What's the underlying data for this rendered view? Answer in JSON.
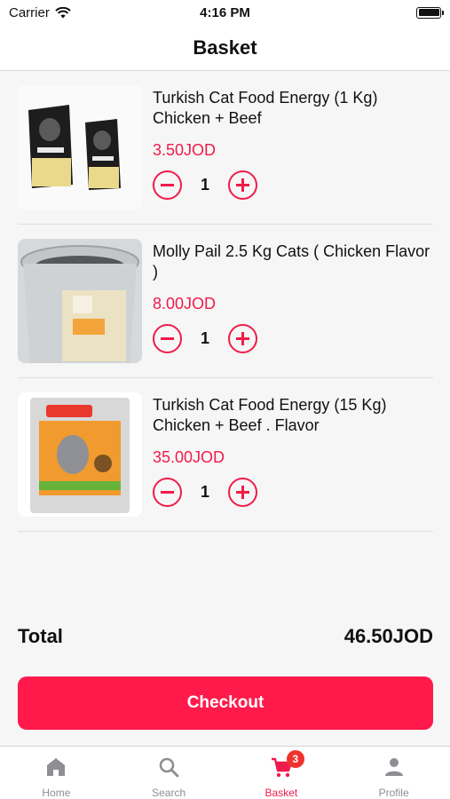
{
  "status_bar": {
    "carrier": "Carrier",
    "time": "4:16 PM"
  },
  "header": {
    "title": "Basket"
  },
  "cart": {
    "items": [
      {
        "name": "Turkish Cat Food Energy (1 Kg) Chicken + Beef",
        "price": "3.50JOD",
        "quantity": "1",
        "image": "cat-food-bags-photo"
      },
      {
        "name": "Molly Pail 2.5 Kg Cats ( Chicken Flavor )",
        "price": "8.00JOD",
        "quantity": "1",
        "image": "cat-food-pail-photo"
      },
      {
        "name": "Turkish Cat Food Energy (15 Kg) Chicken + Beef . Flavor",
        "price": "35.00JOD",
        "quantity": "1",
        "image": "cat-food-large-bag-photo"
      }
    ],
    "total_label": "Total",
    "total_value": "46.50JOD",
    "checkout_label": "Checkout"
  },
  "tab_bar": {
    "tabs": [
      {
        "label": "Home",
        "icon": "home-icon"
      },
      {
        "label": "Search",
        "icon": "search-icon"
      },
      {
        "label": "Basket",
        "icon": "cart-icon",
        "badge": "3",
        "active": true
      },
      {
        "label": "Profile",
        "icon": "person-icon"
      }
    ]
  },
  "colors": {
    "accent": "#f01b4a",
    "checkout": "#ff1a4b",
    "badge": "#f0322f",
    "inactive": "#8e8e93"
  }
}
